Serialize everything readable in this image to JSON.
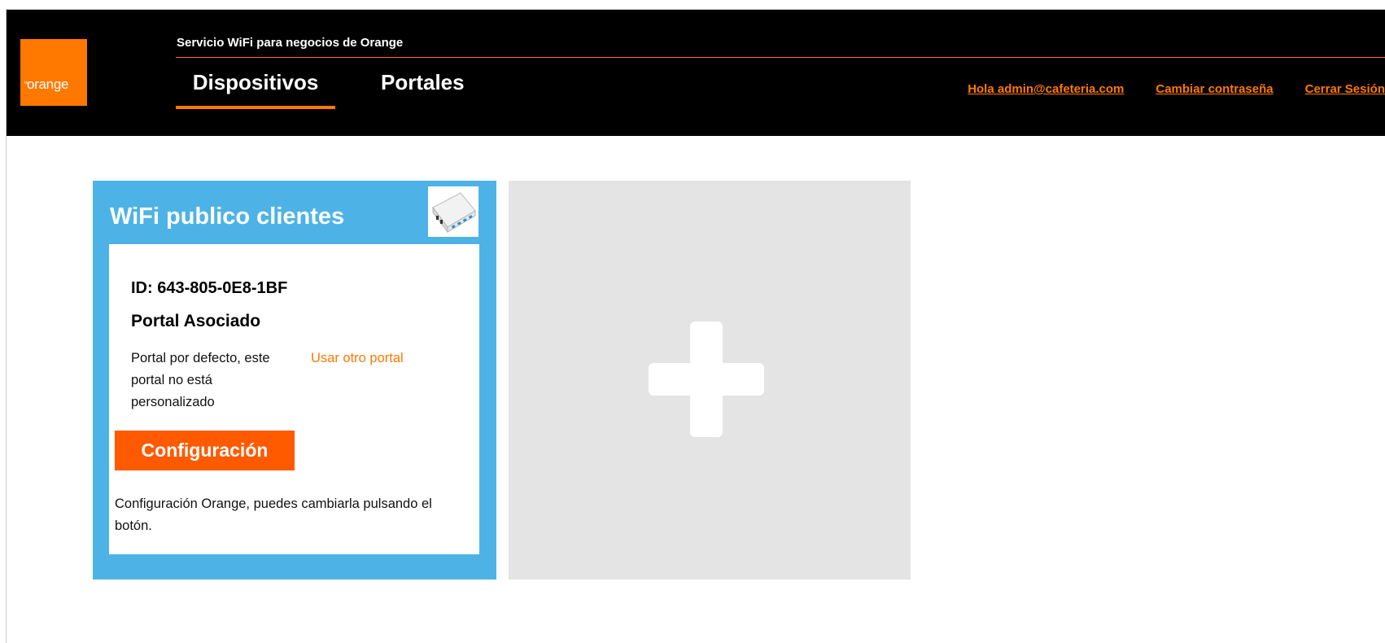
{
  "header": {
    "logo_text": "orange",
    "logo_trademark": "™",
    "service_title": "Servicio WiFi para negocios de Orange",
    "tabs": [
      {
        "label": "Dispositivos",
        "active": true
      },
      {
        "label": "Portales",
        "active": false
      }
    ],
    "links": {
      "greeting": "Hola admin@cafeteria.com",
      "change_password": "Cambiar contraseña",
      "logout": "Cerrar Sesión"
    }
  },
  "device_card": {
    "title": "WiFi publico clientes",
    "thumbnail_icon": "router-image",
    "device_id": "ID: 643-805-0E8-1BF",
    "portal_heading": "Portal Asociado",
    "portal_description": "Portal por defecto, este portal no está personalizado",
    "other_portal_link": "Usar otro portal",
    "config_button": "Configuración",
    "config_note": "Configuración Orange, puedes cambiarla pulsando el botón."
  },
  "add_card": {
    "icon": "plus-icon"
  },
  "colors": {
    "brand_orange": "#ff7900",
    "button_orange": "#ff5a00",
    "card_blue": "#4db3e6",
    "add_card_gray": "#e4e4e4",
    "header_bg": "#000000"
  }
}
